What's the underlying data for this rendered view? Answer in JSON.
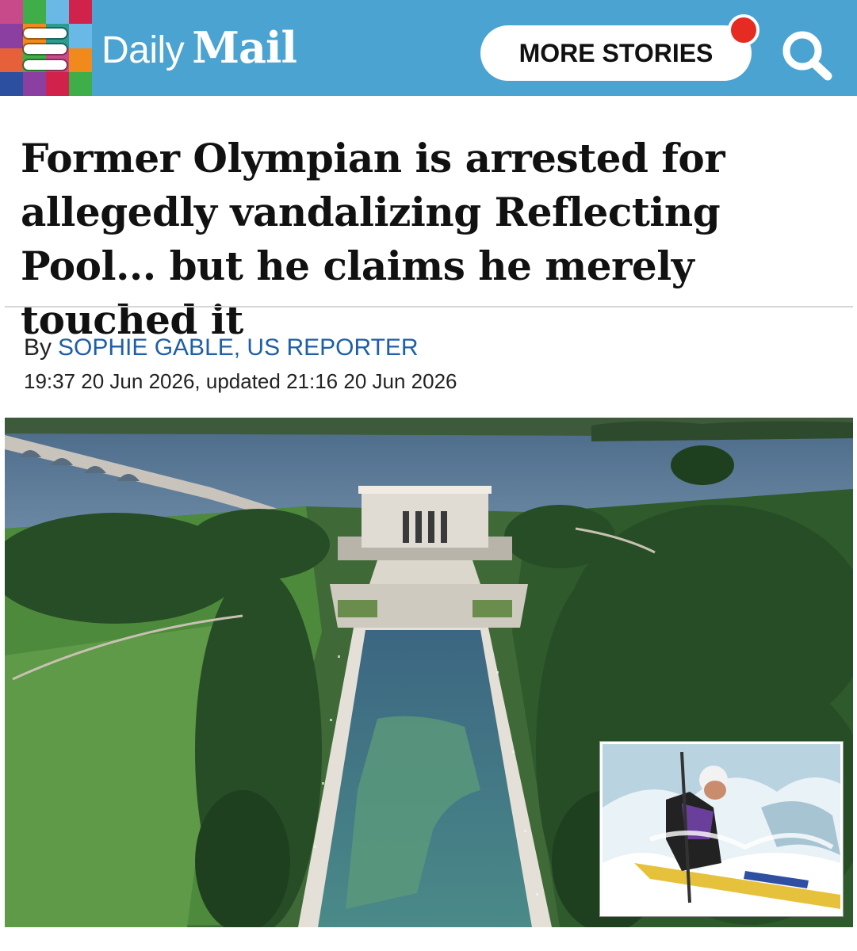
{
  "header": {
    "logo_daily": "Daily",
    "logo_mail": "Mail",
    "more_stories_label": "MORE STORIES",
    "menu_colors": [
      "#c94a8b",
      "#3fae49",
      "#6ab8e6",
      "#d1224b",
      "#8b3fa0",
      "#f08a1c",
      "#2d9b8f",
      "#6ab8e6",
      "#e6603a",
      "#3fae49",
      "#c94a8b",
      "#f08a1c",
      "#2d4fa0",
      "#8b3fa0",
      "#d1224b",
      "#3fae49"
    ],
    "brand_color": "#4aa3d1",
    "notification_color": "#e52b22"
  },
  "article": {
    "headline": "Former Olympian is arrested for allegedly vandalizing Reflecting Pool... but he claims he merely touched it",
    "byline_prefix": "By",
    "author": "SOPHIE GABLE, US REPORTER",
    "dateline": "19:37 20 Jun 2026, updated 21:16 20 Jun 2026"
  },
  "icons": {
    "menu": "hamburger-icon",
    "search": "search-icon",
    "notification": "notification-dot-icon"
  }
}
